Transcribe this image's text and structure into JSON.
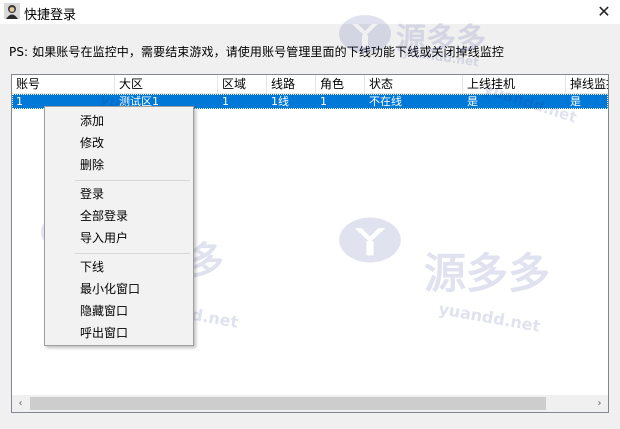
{
  "window": {
    "title": "快捷登录",
    "close_glyph": "✕"
  },
  "note": "PS: 如果账号在监控中，需要结束游戏，请使用账号管理里面的下线功能下线或关闭掉线监控",
  "table": {
    "columns": [
      "账号",
      "大区",
      "区域",
      "线路",
      "角色",
      "状态",
      "上线挂机",
      "掉线监控"
    ],
    "rows": [
      [
        "1",
        "测试区1",
        "1",
        "1线",
        "1",
        "不在线",
        "是",
        "是"
      ]
    ]
  },
  "context_menu": {
    "groups": [
      [
        "添加",
        "修改",
        "删除"
      ],
      [
        "登录",
        "全部登录",
        "导入用户"
      ],
      [
        "下线",
        "最小化窗口",
        "隐藏窗口",
        "呼出窗口"
      ]
    ]
  },
  "scrollbar": {
    "left_glyph": "‹",
    "right_glyph": "›"
  },
  "watermark": {
    "brand": "源多多",
    "url": "yuandd.net"
  },
  "colors": {
    "selection": "#0078d7",
    "menu_bg": "#f2f2f2",
    "watermark": "#1b2a8a"
  }
}
